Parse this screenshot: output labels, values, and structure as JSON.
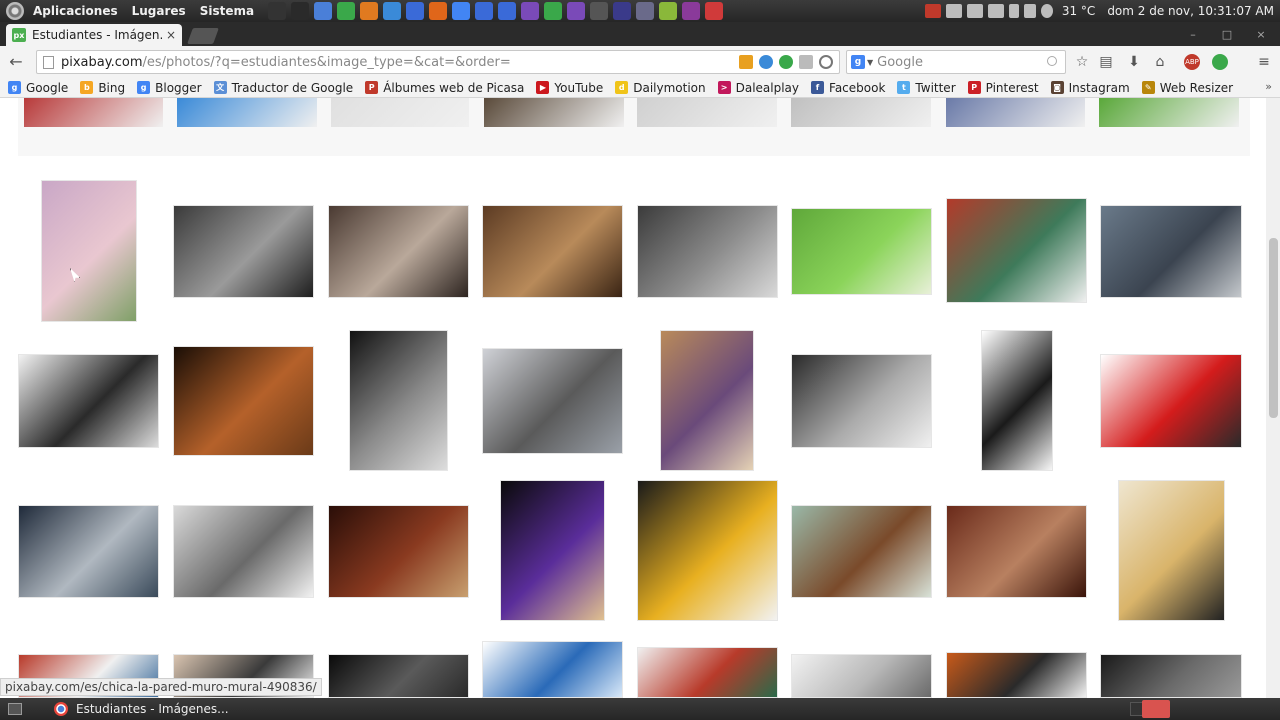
{
  "top_panel": {
    "menus": [
      "Aplicaciones",
      "Lugares",
      "Sistema"
    ],
    "launcher_icons": [
      "terminal-icon",
      "system-monitor-icon",
      "file-icon",
      "spreadsheet-icon",
      "presentation-icon",
      "google-drive-icon",
      "dropbox-icon",
      "firefox-icon",
      "chrome-icon",
      "opera-icon",
      "thunderbird-icon",
      "pidgin-icon",
      "skype-icon",
      "app-icon",
      "tool-icon",
      "tool-icon-2",
      "virtualbox-icon",
      "android-icon",
      "media-icon",
      "shutdown-icon"
    ],
    "weather": "31 °C",
    "clock": "dom  2 de nov, 10:31:07 AM"
  },
  "tab": {
    "title": "Estudiantes - Imágen...",
    "favicon_text": "px",
    "close": "×"
  },
  "window_controls": [
    "–",
    "□",
    "×"
  ],
  "toolbar": {
    "back": "←",
    "url_host": "pixabay.com",
    "url_path": "/es/photos/?q=estudiantes&image_type=&cat=&order=",
    "search_placeholder": "Google",
    "search_engine_letter": "g"
  },
  "bookmarks": [
    {
      "label": "Google",
      "color": "#4285f4",
      "letter": "g"
    },
    {
      "label": "Bing",
      "color": "#f5a623",
      "letter": "b"
    },
    {
      "label": "Blogger",
      "color": "#4285f4",
      "letter": "g"
    },
    {
      "label": "Traductor de Google",
      "color": "#5b8fd6",
      "letter": "文"
    },
    {
      "label": "Álbumes web de Picasa",
      "color": "#c0392b",
      "letter": "P"
    },
    {
      "label": "YouTube",
      "color": "#cc181e",
      "letter": "▶"
    },
    {
      "label": "Dailymotion",
      "color": "#f0c419",
      "letter": "d"
    },
    {
      "label": "Dalealplay",
      "color": "#c2185b",
      "letter": ">"
    },
    {
      "label": "Facebook",
      "color": "#3b5998",
      "letter": "f"
    },
    {
      "label": "Twitter",
      "color": "#55acee",
      "letter": "t"
    },
    {
      "label": "Pinterest",
      "color": "#cb2027",
      "letter": "P"
    },
    {
      "label": "Instagram",
      "color": "#5a4233",
      "letter": "◙"
    },
    {
      "label": "Web Resizer",
      "color": "#b8860b",
      "letter": "✎"
    }
  ],
  "bookmarks_more": "»",
  "status_url": "pixabay.com/es/chica-la-pared-muro-mural-490836/",
  "taskbar": {
    "task_label": "Estudiantes - Imágenes..."
  },
  "images": [
    {
      "name": "girl-by-mural-photo",
      "colors": [
        "#c9a7c6",
        "#e9c7d0",
        "#7fa067"
      ]
    },
    {
      "name": "book-and-glasses-photo",
      "colors": [
        "#3a3a3a",
        "#9a9a9a",
        "#1e1e1e"
      ]
    },
    {
      "name": "laptop-typing-photo",
      "colors": [
        "#4a3a32",
        "#b9a89a",
        "#2d2420"
      ]
    },
    {
      "name": "classroom-africa-photo",
      "colors": [
        "#5c3b23",
        "#b88a5a",
        "#3a2414"
      ]
    },
    {
      "name": "laptop-apps-photo",
      "colors": [
        "#3b3b3b",
        "#8c8c8c",
        "#d9d9d9"
      ]
    },
    {
      "name": "butterfly-daisies-photo",
      "colors": [
        "#5fa83a",
        "#8bd45a",
        "#e8f0d8"
      ]
    },
    {
      "name": "stack-of-books-photo",
      "colors": [
        "#b33a2a",
        "#3e7a5a",
        "#f0f0f0"
      ]
    },
    {
      "name": "laptop-hands-photo",
      "colors": [
        "#6a7a8a",
        "#3b4450",
        "#c4c8cc"
      ]
    },
    {
      "name": "camera-photo",
      "colors": [
        "#f2f2f2",
        "#2a2a2a",
        "#dcdcdc"
      ]
    },
    {
      "name": "lamp-and-book-photo",
      "colors": [
        "#1a0e06",
        "#b5612a",
        "#6a3a18"
      ]
    },
    {
      "name": "woman-black-white-photo",
      "colors": [
        "#111111",
        "#8a8a8a",
        "#dddddd"
      ]
    },
    {
      "name": "microphone-photo",
      "colors": [
        "#cfd1d6",
        "#5a5a5a",
        "#9aa0a8"
      ]
    },
    {
      "name": "woman-reading-library-photo",
      "colors": [
        "#b98a5a",
        "#6a4a7a",
        "#e5d2b5"
      ]
    },
    {
      "name": "students-blackboard-photo",
      "colors": [
        "#2a2a2a",
        "#aaaaaa",
        "#f0f0f0"
      ]
    },
    {
      "name": "stick-figure-drawing",
      "colors": [
        "#ffffff",
        "#1a1a1a",
        "#f7f7f7"
      ]
    },
    {
      "name": "girl-red-laptop-photo",
      "colors": [
        "#ffffff",
        "#d41c1c",
        "#2a2a2a"
      ]
    },
    {
      "name": "hands-mixing-console-photo",
      "colors": [
        "#1f2a3a",
        "#b0b8c0",
        "#3a4a5a"
      ]
    },
    {
      "name": "mixing-console-photo",
      "colors": [
        "#d9d9d9",
        "#6a6a6a",
        "#f2f2f2"
      ]
    },
    {
      "name": "candle-and-book-photo",
      "colors": [
        "#2a0e08",
        "#8a3a20",
        "#c8a070"
      ]
    },
    {
      "name": "woman-purple-dress-photo",
      "colors": [
        "#0a0a0a",
        "#5a2d9a",
        "#e0c090"
      ]
    },
    {
      "name": "back-to-school-bus-photo",
      "colors": [
        "#1a1a1a",
        "#e8b020",
        "#f2f2f2"
      ]
    },
    {
      "name": "library-room-photo",
      "colors": [
        "#9ab8a8",
        "#7a4a2a",
        "#d8e2d8"
      ]
    },
    {
      "name": "old-books-photo",
      "colors": [
        "#6a2a1a",
        "#b88060",
        "#3a140a"
      ]
    },
    {
      "name": "blonde-woman-photo",
      "colors": [
        "#efe6d0",
        "#d9b46a",
        "#222222"
      ]
    },
    {
      "name": "books-stack-bottom-photo",
      "colors": [
        "#b83a2a",
        "#f0f0f0",
        "#3a6a9a"
      ]
    },
    {
      "name": "man-glasses-photo",
      "colors": [
        "#d9c4b0",
        "#3a3a3a",
        "#f0f0f0"
      ]
    },
    {
      "name": "flexing-arms-photo",
      "colors": [
        "#0a0a0a",
        "#5a5a5a",
        "#2a2a2a"
      ]
    },
    {
      "name": "history-book-drawing",
      "colors": [
        "#ffffff",
        "#2a6ab8",
        "#d8e8f8"
      ]
    },
    {
      "name": "colored-books-photo",
      "colors": [
        "#f0f0f0",
        "#b83a2a",
        "#2a6a4a"
      ]
    },
    {
      "name": "bright-room-photo",
      "colors": [
        "#f2f2f2",
        "#b8b8b8",
        "#6a6a6a"
      ]
    },
    {
      "name": "chalkboard-thinking-photo",
      "colors": [
        "#c85a1a",
        "#2a2a2a",
        "#f0f0f0"
      ]
    },
    {
      "name": "camera-lens-photo",
      "colors": [
        "#1a1a1a",
        "#6a6a6a",
        "#9a9a9a"
      ]
    }
  ]
}
